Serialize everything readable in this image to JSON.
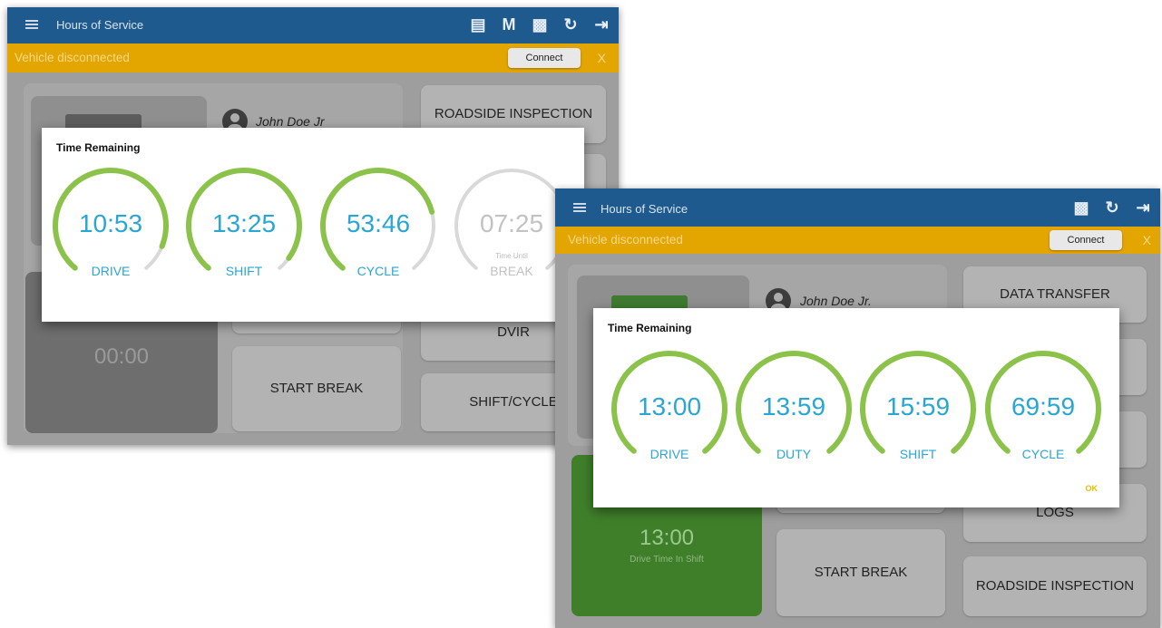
{
  "screen1": {
    "app_title": "Hours of Service",
    "banner": {
      "text": "Vehicle disconnected",
      "connect_label": "Connect",
      "close_label": "X"
    },
    "driver_name": "John Doe Jr",
    "clock": "00:00",
    "tiles": {
      "roadside": "ROADSIDE INSPECTION",
      "dvir": "DVIR",
      "start_break": "START BREAK",
      "shift_cycle": "SHIFT/CYCLE"
    },
    "dialog": {
      "title": "Time Remaining",
      "gauges": [
        {
          "time": "10:53",
          "label": "DRIVE",
          "sub": "",
          "fraction": 0.9
        },
        {
          "time": "13:25",
          "label": "SHIFT",
          "sub": "",
          "fraction": 0.95
        },
        {
          "time": "53:46",
          "label": "CYCLE",
          "sub": "",
          "fraction": 0.77
        },
        {
          "time": "07:25",
          "label": "BREAK",
          "sub": "Time Until",
          "fraction": 0
        }
      ]
    }
  },
  "screen2": {
    "app_title": "Hours of Service",
    "banner": {
      "text": "Vehicle disconnected",
      "connect_label": "Connect",
      "close_label": "X"
    },
    "driver_name": "John Doe Jr.",
    "clock": "13:00",
    "clock_caption": "Drive Time In Shift",
    "tiles": {
      "data_transfer": "DATA TRANSFER",
      "logs": "LOGS",
      "start_break": "START BREAK",
      "roadside": "ROADSIDE INSPECTION"
    },
    "dialog": {
      "title": "Time Remaining",
      "ok_label": "OK",
      "gauges": [
        {
          "time": "13:00",
          "label": "DRIVE",
          "fraction": 1
        },
        {
          "time": "13:59",
          "label": "DUTY",
          "fraction": 1
        },
        {
          "time": "15:59",
          "label": "SHIFT",
          "fraction": 1
        },
        {
          "time": "69:59",
          "label": "CYCLE",
          "fraction": 1
        }
      ]
    }
  },
  "colors": {
    "appbar": "#1e5a8e",
    "banner": "#e3a500",
    "gauge_green": "#8bc34a",
    "gauge_track": "#d9d9d9",
    "gauge_text": "#2aa6d4",
    "drive_tile_green": "#4caf50",
    "ok_yellow": "#e3c000"
  },
  "icons": {
    "screen1_appbar": [
      "message-icon",
      "m-icon",
      "monitor-icon",
      "refresh-icon",
      "logout-icon"
    ],
    "screen2_appbar": [
      "monitor-icon",
      "refresh-icon",
      "logout-icon"
    ]
  }
}
